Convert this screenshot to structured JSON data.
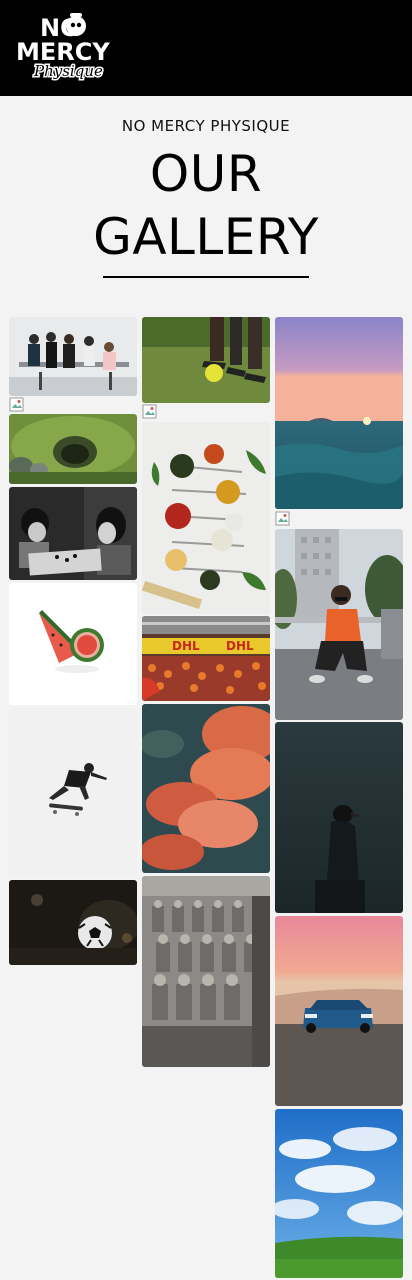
{
  "header": {
    "logo_alt": "No Mercy Physique",
    "logo_line1": "NO",
    "logo_line2": "MERCY",
    "logo_line3": "Physique"
  },
  "hero": {
    "eyebrow": "NO MERCY PHYSIQUE",
    "title_line1": "OUR",
    "title_line2": "GALLERY"
  },
  "gallery": {
    "images": [
      {
        "subject": "team meeting"
      },
      {
        "subject": "soccer feet"
      },
      {
        "subject": "sunset sea"
      },
      {
        "subject": "mossy hill"
      },
      {
        "subject": "spices"
      },
      {
        "subject": "board game"
      },
      {
        "subject": "watermelon"
      },
      {
        "subject": "stadium crowd"
      },
      {
        "subject": "woman crouching"
      },
      {
        "subject": "skateboarder"
      },
      {
        "subject": "red clouds"
      },
      {
        "subject": "crow"
      },
      {
        "subject": "soccer ball"
      },
      {
        "subject": "terracotta army"
      },
      {
        "subject": "blue car"
      },
      {
        "subject": "blue sky"
      }
    ]
  },
  "colors": {
    "header_bg": "#000000",
    "page_bg": "#f3f3f3",
    "text": "#000000"
  }
}
